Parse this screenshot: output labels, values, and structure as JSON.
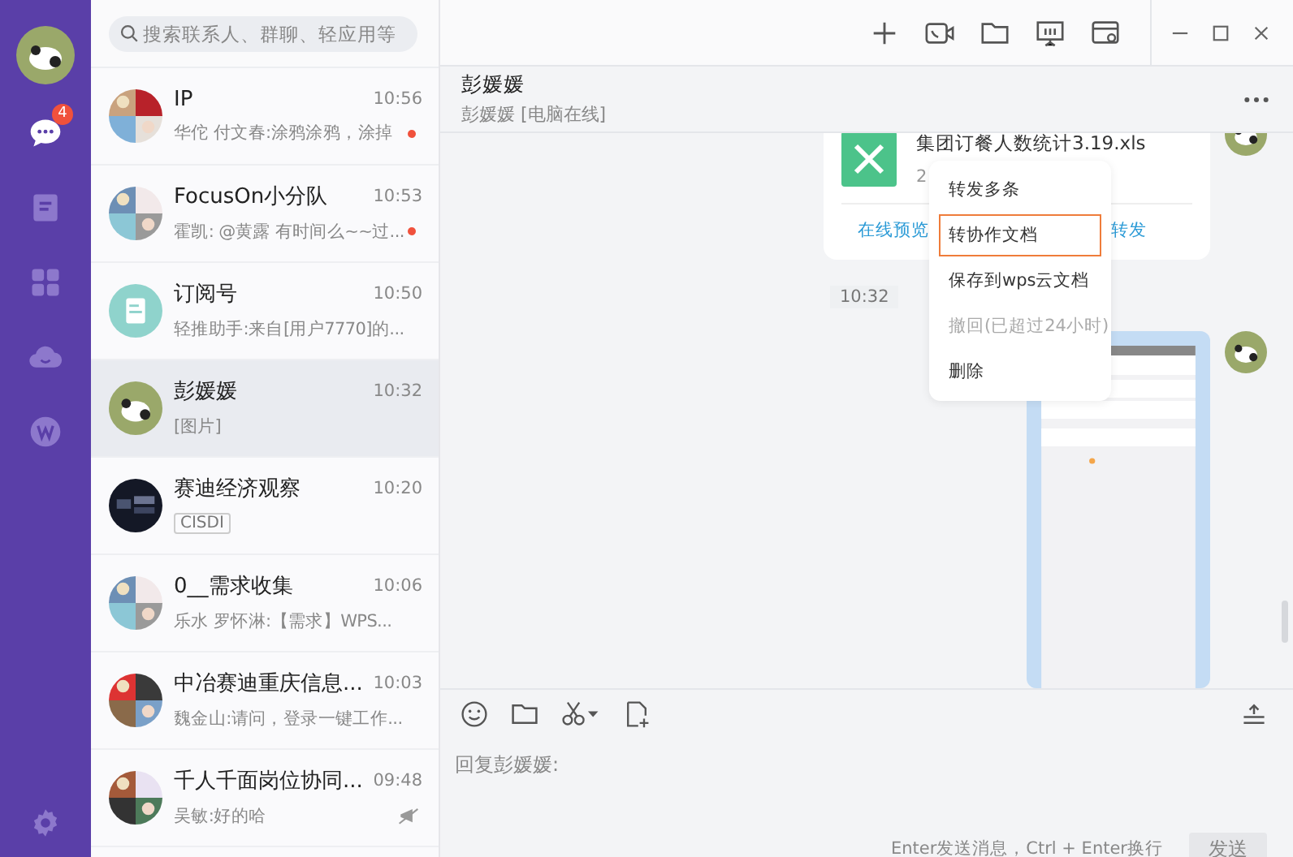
{
  "rail": {
    "items": [
      {
        "kind": "chat",
        "badge": "4",
        "selected": true
      },
      {
        "kind": "contacts",
        "selected": false
      },
      {
        "kind": "apps",
        "selected": false
      },
      {
        "kind": "cloud",
        "selected": false
      },
      {
        "kind": "docs",
        "selected": false
      }
    ]
  },
  "search": {
    "placeholder": "搜索联系人、群聊、轻应用等"
  },
  "conversations": [
    {
      "kind": "group",
      "name": "IP",
      "time": "10:56",
      "preview": "华佗 付文春:涂鸦涂鸦，涂掉",
      "unread": true,
      "muted": false,
      "selected": false
    },
    {
      "kind": "group",
      "name": "FocusOn小分队",
      "time": "10:53",
      "preview": "霍凯: @黄露 有时间么~~过...",
      "unread": true,
      "muted": false,
      "selected": false
    },
    {
      "kind": "subscription",
      "name": "订阅号",
      "time": "10:50",
      "preview": "轻推助手:来自[用户7770]的...",
      "unread": false,
      "muted": false,
      "selected": false
    },
    {
      "kind": "panda",
      "name": "彭媛媛",
      "time": "10:32",
      "preview": "[图片]",
      "unread": false,
      "muted": false,
      "selected": true
    },
    {
      "kind": "logo",
      "name": "赛迪经济观察",
      "time": "10:20",
      "tag": "CISDI",
      "unread": false,
      "muted": false,
      "selected": false
    },
    {
      "kind": "group",
      "name": "0__需求收集",
      "time": "10:06",
      "preview": "乐水 罗怀淋:【需求】WPS...",
      "unread": false,
      "muted": false,
      "selected": false
    },
    {
      "kind": "group",
      "name": "中冶赛迪重庆信息...",
      "time": "10:03",
      "preview": "魏金山:请问，登录一键工作...",
      "unread": false,
      "muted": false,
      "selected": false
    },
    {
      "kind": "group",
      "name": "千人千面岗位协同...",
      "time": "09:48",
      "preview": "吴敏:好的哈",
      "unread": false,
      "muted": true,
      "selected": false
    }
  ],
  "chat": {
    "title": "彭媛媛",
    "subtitle": "彭媛媛 [电脑在线]",
    "file": {
      "name": "集团订餐人数统计3.19.xls",
      "size": "2",
      "actions": [
        "在线预览",
        "转发"
      ]
    },
    "timestamp": "10:32",
    "menu": [
      {
        "label": "转发多条",
        "disabled": false,
        "selected": false
      },
      {
        "label": "转协作文档",
        "disabled": false,
        "selected": true
      },
      {
        "label": "保存到wps云文档",
        "disabled": false,
        "selected": false
      },
      {
        "label": "撤回(已超过24小时)",
        "disabled": true,
        "selected": false
      },
      {
        "label": "删除",
        "disabled": false,
        "selected": false
      }
    ]
  },
  "composer": {
    "placeholder": "回复彭媛媛:",
    "hint": "Enter发送消息，Ctrl + Enter换行",
    "send": "发送"
  }
}
